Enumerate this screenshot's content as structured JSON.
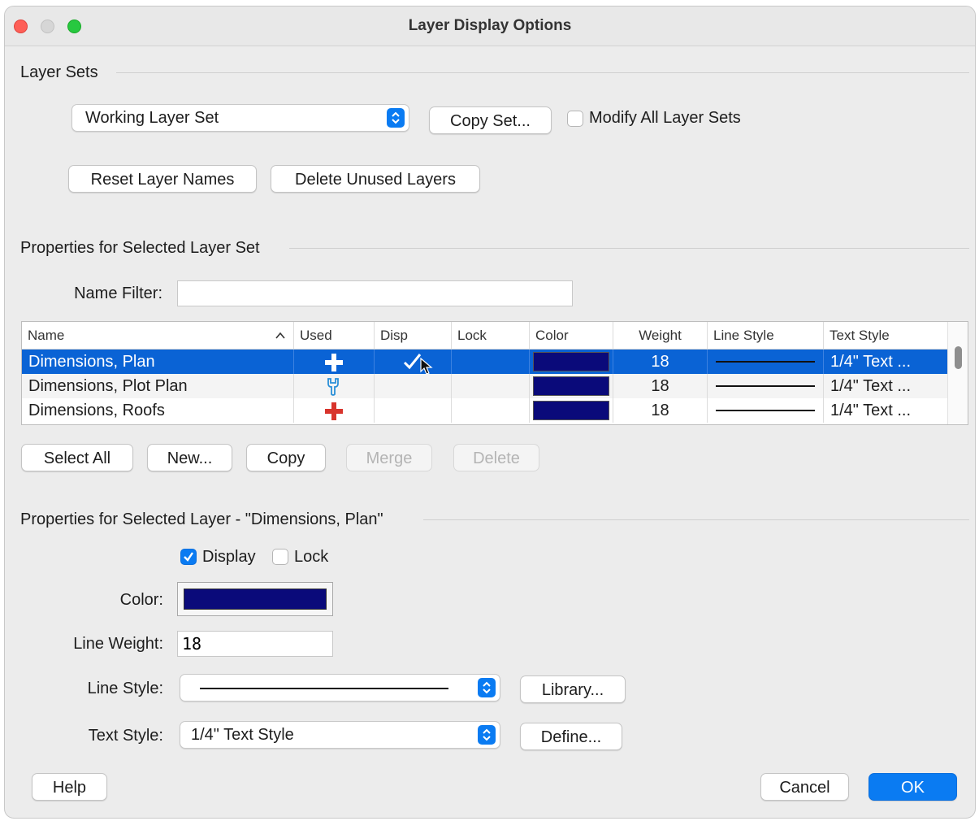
{
  "window": {
    "title": "Layer Display Options"
  },
  "layer_sets": {
    "section_label": "Layer Sets",
    "set_select_value": "Working Layer Set",
    "copy_set_label": "Copy Set...",
    "modify_all_label": "Modify All Layer Sets",
    "modify_all_checked": false,
    "reset_names_label": "Reset Layer Names",
    "delete_unused_label": "Delete Unused Layers"
  },
  "set_properties": {
    "section_label": "Properties for Selected Layer Set",
    "name_filter_label": "Name Filter:",
    "name_filter_value": ""
  },
  "table": {
    "columns": [
      "Name",
      "Used",
      "Disp",
      "Lock",
      "Color",
      "Weight",
      "Line Style",
      "Text Style"
    ],
    "sort_indicator": "^",
    "rows": [
      {
        "name": "Dimensions, Plan",
        "used_icon": "white-plus-icon",
        "disp": "✓",
        "lock": "",
        "color": "#0a0a7a",
        "weight": "18",
        "text_style": "1/4\" Text ...",
        "selected": true
      },
      {
        "name": "Dimensions, Plot Plan",
        "used_icon": "wrench-icon",
        "disp": "",
        "lock": "",
        "color": "#0a0a7a",
        "weight": "18",
        "text_style": "1/4\" Text ...",
        "selected": false
      },
      {
        "name": "Dimensions, Roofs",
        "used_icon": "red-plus-icon",
        "disp": "",
        "lock": "",
        "color": "#0a0a7a",
        "weight": "18",
        "text_style": "1/4\" Text ...",
        "selected": false
      }
    ]
  },
  "table_buttons": {
    "select_all": "Select All",
    "new": "New...",
    "copy": "Copy",
    "merge": "Merge",
    "delete": "Delete"
  },
  "layer_properties": {
    "section_label": "Properties for Selected Layer - \"Dimensions, Plan\"",
    "display_label": "Display",
    "display_checked": true,
    "lock_label": "Lock",
    "lock_checked": false,
    "color_label": "Color:",
    "color_value": "#0a0a7a",
    "line_weight_label": "Line Weight:",
    "line_weight_value": "18",
    "line_style_label": "Line Style:",
    "library_label": "Library...",
    "text_style_label": "Text Style:",
    "text_style_value": "1/4\" Text Style",
    "define_label": "Define..."
  },
  "footer": {
    "help": "Help",
    "cancel": "Cancel",
    "ok": "OK"
  },
  "colors": {
    "accent": "#0a7bf2",
    "selection": "#0a63d5",
    "layer_color": "#0a0a7a",
    "used_plus_red": "#d8342c",
    "wrench_blue": "#2a8fd8"
  }
}
